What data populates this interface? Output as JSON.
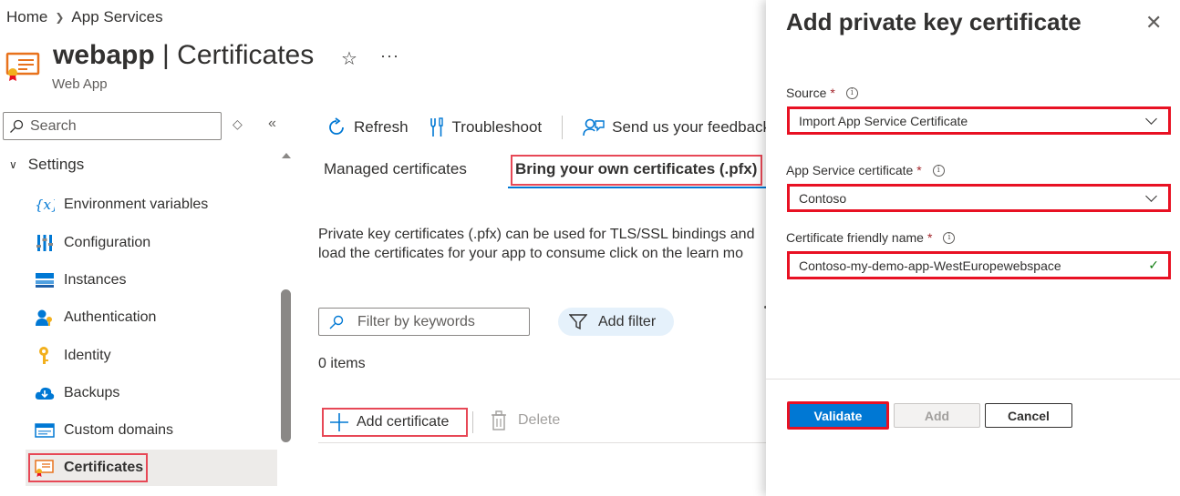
{
  "breadcrumb": {
    "home": "Home",
    "app_services": "App Services"
  },
  "header": {
    "resource_name": "webapp",
    "separator": "|",
    "page_name": "Certificates",
    "subtitle": "Web App",
    "star": "☆",
    "more": "···"
  },
  "sidebar": {
    "search_placeholder": "Search",
    "group_label": "Settings",
    "items": [
      {
        "label": "Environment variables",
        "icon": "variable-icon"
      },
      {
        "label": "Configuration",
        "icon": "configuration-icon"
      },
      {
        "label": "Instances",
        "icon": "instances-icon"
      },
      {
        "label": "Authentication",
        "icon": "authentication-icon"
      },
      {
        "label": "Identity",
        "icon": "identity-icon"
      },
      {
        "label": "Backups",
        "icon": "backups-icon"
      },
      {
        "label": "Custom domains",
        "icon": "custom-domains-icon"
      },
      {
        "label": "Certificates",
        "icon": "certificate-icon",
        "active": true
      }
    ]
  },
  "toolbar": {
    "refresh": "Refresh",
    "troubleshoot": "Troubleshoot",
    "feedback": "Send us your feedback"
  },
  "tabs": {
    "managed": "Managed certificates",
    "byo": "Bring your own certificates (.pfx)"
  },
  "main": {
    "description_line1": "Private key certificates (.pfx) can be used for TLS/SSL bindings and",
    "description_line2": "load the certificates for your app to consume click on the learn mo",
    "filter_placeholder": "Filter by keywords",
    "add_filter": "Add filter",
    "items_count": "0 items",
    "add_certificate": "Add certificate",
    "delete": "Delete"
  },
  "panel": {
    "title": "Add private key certificate",
    "source_label": "Source",
    "source_value": "Import App Service Certificate",
    "app_cert_label": "App Service certificate",
    "app_cert_value": "Contoso",
    "friendly_label": "Certificate friendly name",
    "friendly_value": "Contoso-my-demo-app-WestEuropewebspace",
    "required_mark": "*",
    "info_mark": "i",
    "validate": "Validate",
    "add": "Add",
    "cancel": "Cancel"
  },
  "colors": {
    "accent": "#0078d4",
    "highlight": "#e81123",
    "success": "#107c10"
  }
}
